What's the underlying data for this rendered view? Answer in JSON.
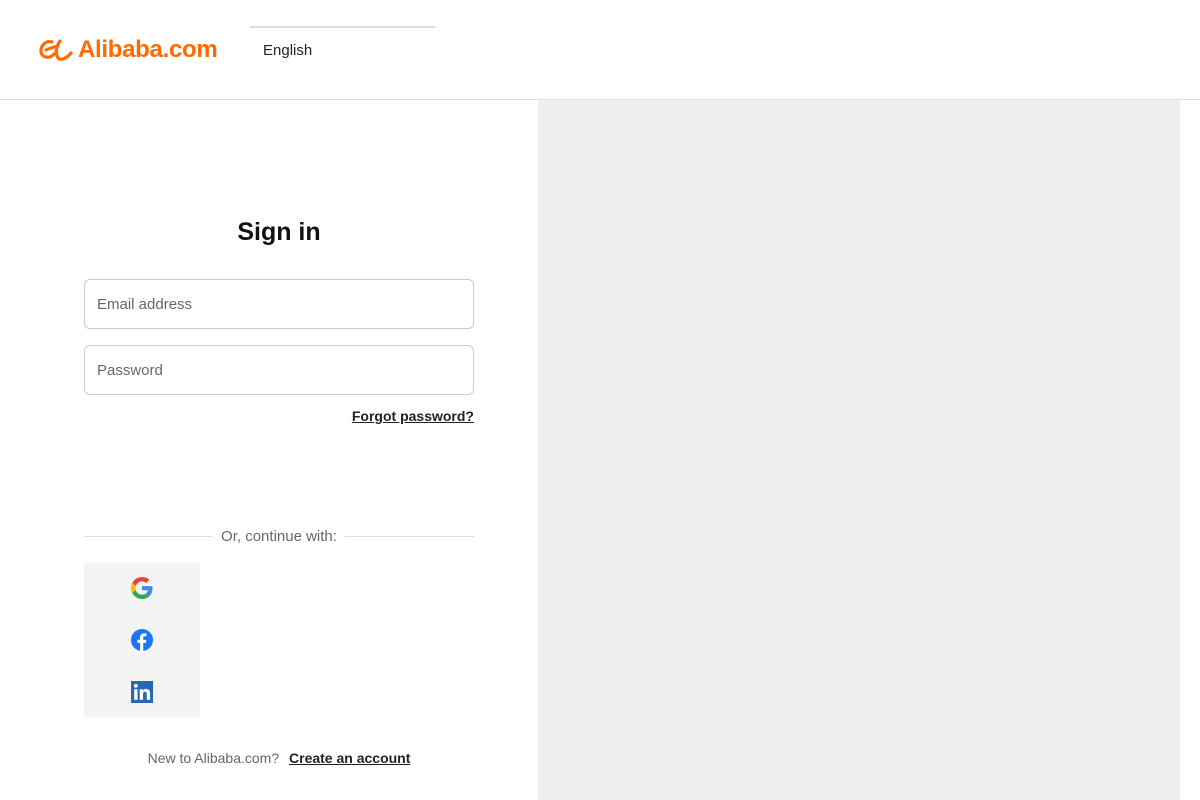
{
  "header": {
    "logo_text": "Alibaba.com",
    "language": "English"
  },
  "signin": {
    "title": "Sign in",
    "email_placeholder": "Email address",
    "password_placeholder": "Password",
    "forgot_label": "Forgot password?",
    "divider_text": "Or, continue with:",
    "social": [
      {
        "name": "Google",
        "icon": "google-icon"
      },
      {
        "name": "Facebook",
        "icon": "facebook-icon"
      },
      {
        "name": "LinkedIn",
        "icon": "linkedin-icon"
      }
    ],
    "new_user_text": "New to Alibaba.com?",
    "create_account_label": "Create an account"
  },
  "colors": {
    "brand_orange": "#ff6a00",
    "right_panel_bg": "#efefef",
    "facebook_blue": "#1877f2",
    "linkedin_blue": "#2867b2"
  }
}
